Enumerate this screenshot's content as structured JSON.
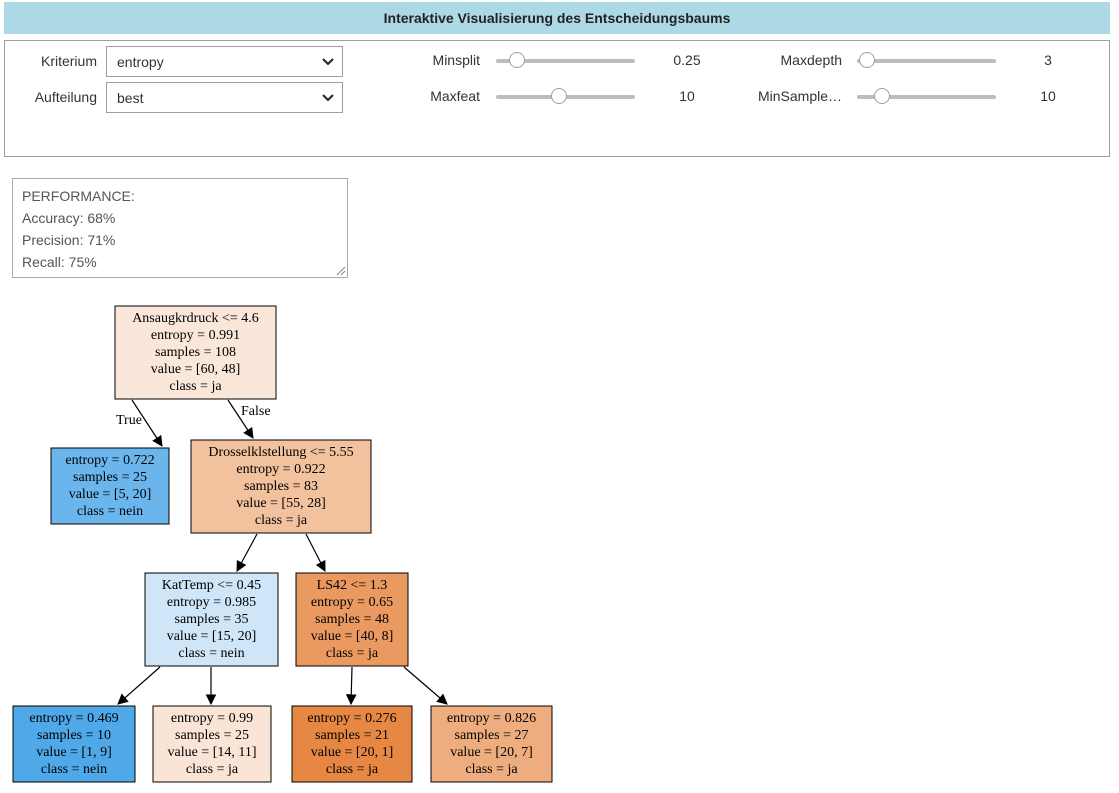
{
  "title": "Interaktive Visualisierung des Entscheidungsbaums",
  "controls": {
    "kriterium": {
      "label": "Kriterium",
      "value": "entropy"
    },
    "aufteilung": {
      "label": "Aufteilung",
      "value": "best"
    },
    "minsplit": {
      "label": "Minsplit",
      "value": "0.25",
      "level": 0.15
    },
    "maxfeat": {
      "label": "Maxfeat",
      "value": "10",
      "level": 0.45
    },
    "maxdepth": {
      "label": "Maxdepth",
      "value": "3",
      "level": 0.07
    },
    "minsample": {
      "label": "MinSample…",
      "value": "10",
      "level": 0.18
    }
  },
  "performance": {
    "heading": "PERFORMANCE:",
    "accuracy": "Accuracy: 68%",
    "precision": "Precision: 71%",
    "recall": "Recall: 75%"
  },
  "tree": {
    "edge_true": "True",
    "edge_false": "False",
    "nodes": [
      {
        "lines": [
          "Ansaugkrdruck <= 4.6",
          "entropy = 0.991",
          "samples = 108",
          "value = [60, 48]",
          "class = ja"
        ],
        "fill": "#fae7da"
      },
      {
        "lines": [
          "entropy = 0.722",
          "samples = 25",
          "value = [5, 20]",
          "class = nein"
        ],
        "fill": "#6ab6ec"
      },
      {
        "lines": [
          "Drosselklstellung <= 5.55",
          "entropy = 0.922",
          "samples = 83",
          "value = [55, 28]",
          "class = ja"
        ],
        "fill": "#f2c19e"
      },
      {
        "lines": [
          "KatTemp <= 0.45",
          "entropy = 0.985",
          "samples = 35",
          "value = [15, 20]",
          "class = nein"
        ],
        "fill": "#cee6f8"
      },
      {
        "lines": [
          "LS42 <= 1.3",
          "entropy = 0.65",
          "samples = 48",
          "value = [40, 8]",
          "class = ja"
        ],
        "fill": "#ea9a61"
      },
      {
        "lines": [
          "entropy = 0.469",
          "samples = 10",
          "value = [1, 9]",
          "class = nein"
        ],
        "fill": "#4fa8e8"
      },
      {
        "lines": [
          "entropy = 0.99",
          "samples = 25",
          "value = [14, 11]",
          "class = ja"
        ],
        "fill": "#f9e4d5"
      },
      {
        "lines": [
          "entropy = 0.276",
          "samples = 21",
          "value = [20, 1]",
          "class = ja"
        ],
        "fill": "#e68743"
      },
      {
        "lines": [
          "entropy = 0.826",
          "samples = 27",
          "value = [20, 7]",
          "class = ja"
        ],
        "fill": "#eead7e"
      }
    ]
  }
}
